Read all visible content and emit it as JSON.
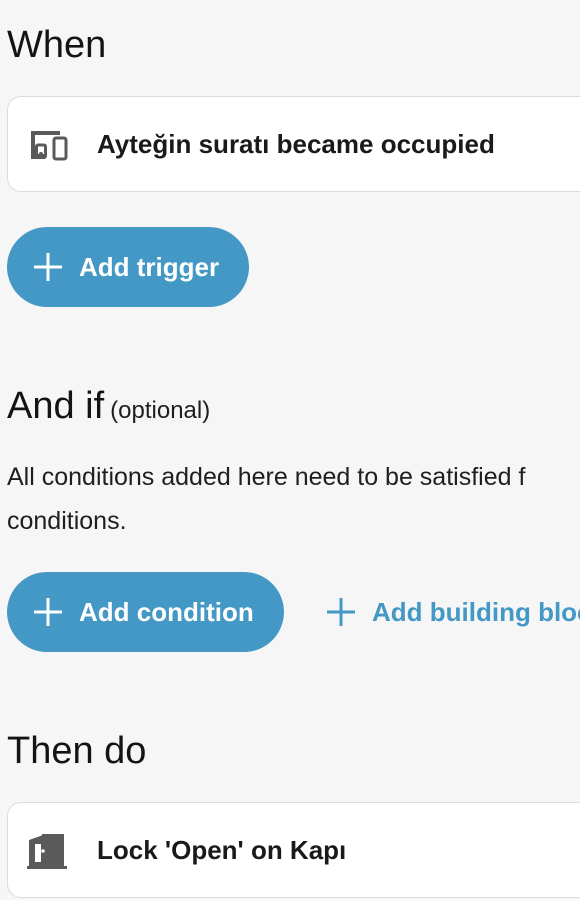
{
  "when": {
    "title": "When",
    "trigger_card": {
      "icon": "device-icon",
      "label": "Ayteğin suratı became occupied"
    },
    "add_trigger_label": "Add trigger"
  },
  "and_if": {
    "title": "And if",
    "optional_label": "(optional)",
    "description": "All conditions added here need to be satisfied f conditions.",
    "add_condition_label": "Add condition",
    "add_building_block_label": "Add building bloc"
  },
  "then_do": {
    "title": "Then do",
    "action_card": {
      "icon": "door-icon",
      "label": "Lock 'Open' on Kapı"
    }
  },
  "colors": {
    "accent": "#4398c6",
    "background": "#f6f6f6",
    "card": "#ffffff",
    "card_border": "#dcdcdc"
  }
}
